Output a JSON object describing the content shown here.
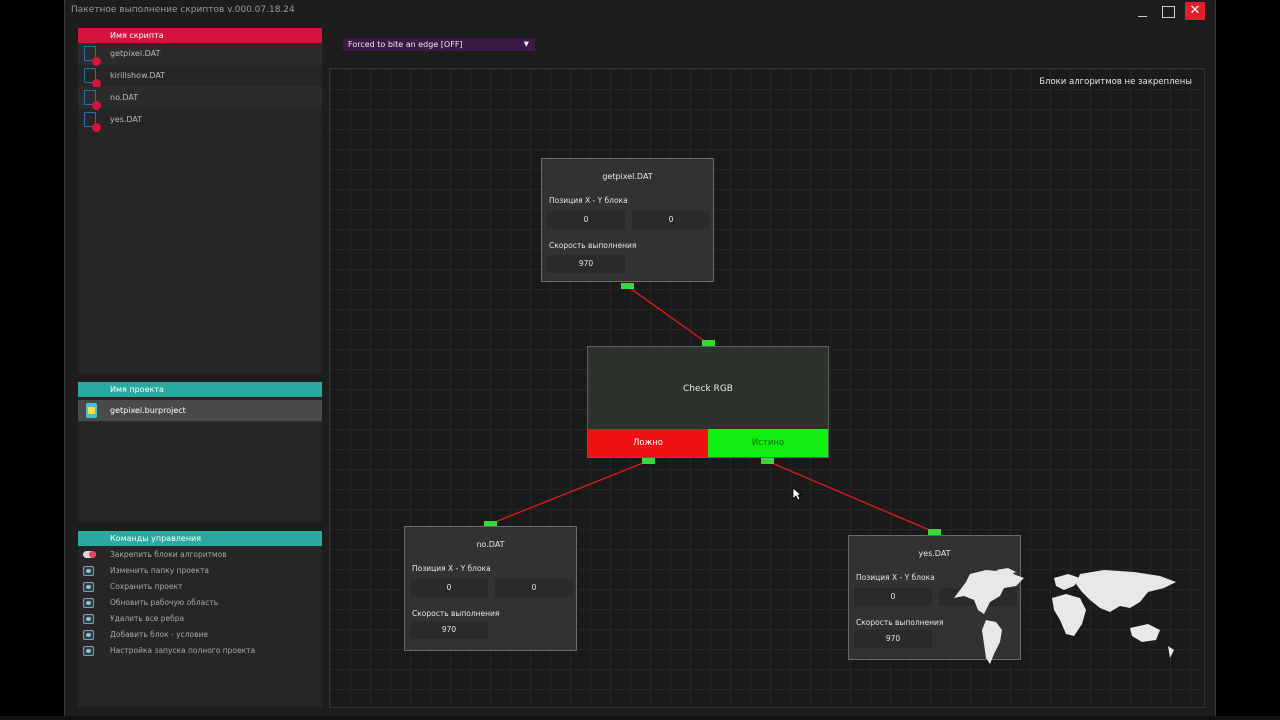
{
  "window": {
    "title": "Пакетное выполнение скриптов v.000.07.18.24"
  },
  "scripts_panel": {
    "header": "Имя скрипта",
    "items": [
      {
        "label": "getpixel.DAT"
      },
      {
        "label": "kirillshow.DAT"
      },
      {
        "label": "no.DAT"
      },
      {
        "label": "yes.DAT"
      }
    ]
  },
  "project_panel": {
    "header": "Имя проекта",
    "items": [
      {
        "label": "getpixel.burproject"
      }
    ]
  },
  "commands_panel": {
    "header": "Команды управления",
    "items": [
      {
        "label": "Закрепить блоки алгоритмов",
        "icon": "toggle-icon"
      },
      {
        "label": "Изменить папку проекта",
        "icon": "gear-icon"
      },
      {
        "label": "Сохранить проект",
        "icon": "gear-icon"
      },
      {
        "label": "Обновить рабочую область",
        "icon": "gear-icon"
      },
      {
        "label": "Удалить все ребра",
        "icon": "gear-icon"
      },
      {
        "label": "Добавить блок - условие",
        "icon": "gear-icon"
      },
      {
        "label": "Настройка запуска полного проекта",
        "icon": "gear-icon"
      }
    ]
  },
  "toolbar": {
    "edge_mode": "Forced to bite an edge [OFF]"
  },
  "canvas": {
    "status": "Блоки алгоритмов не закреплены",
    "nodes": [
      {
        "title": "getpixel.DAT",
        "pos_label": "Позиция X - Y блока",
        "x": "0",
        "y": "0",
        "speed_label": "Скорость выполнения",
        "speed": "970"
      },
      {
        "title": "no.DAT",
        "pos_label": "Позиция X - Y блока",
        "x": "0",
        "y": "0",
        "speed_label": "Скорость выполнения",
        "speed": "970"
      },
      {
        "title": "yes.DAT",
        "pos_label": "Позиция X - Y блока",
        "x": "0",
        "speed_label": "Скорость выполнения",
        "speed": "970"
      }
    ],
    "condition": {
      "title": "Check RGB",
      "false_label": "Ложно",
      "true_label": "Истино"
    }
  },
  "colors": {
    "accent_red": "#d6133f",
    "accent_teal": "#2aa9a1",
    "port_green": "#39d839",
    "wire_red": "#e01a1a"
  }
}
